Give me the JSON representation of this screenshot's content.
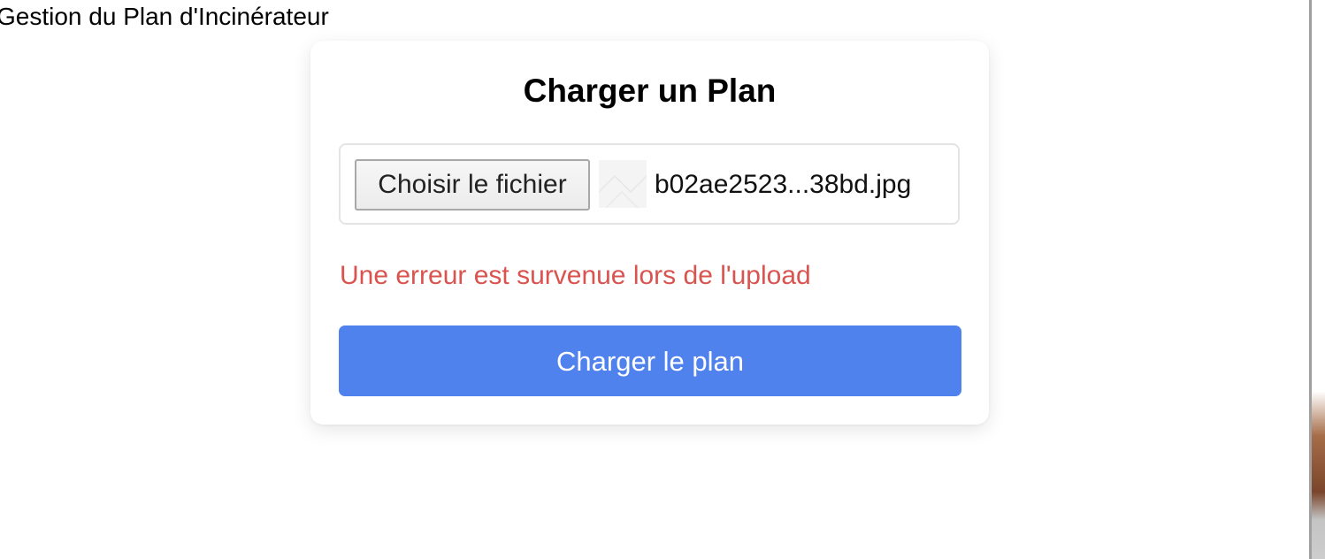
{
  "page": {
    "heading": "Gestion du Plan d'Incinérateur"
  },
  "upload_card": {
    "title": "Charger un Plan",
    "file_input": {
      "button_label": "Choisir le fichier",
      "selected_file_name": "b02ae2523...38bd.jpg",
      "thumbnail_icon": "broken-image-icon"
    },
    "error_message": "Une erreur est survenue lors de l'upload",
    "submit_label": "Charger le plan"
  },
  "colors": {
    "primary_button": "#5082ed",
    "error_text": "#d9534f",
    "card_background": "#ffffff"
  }
}
